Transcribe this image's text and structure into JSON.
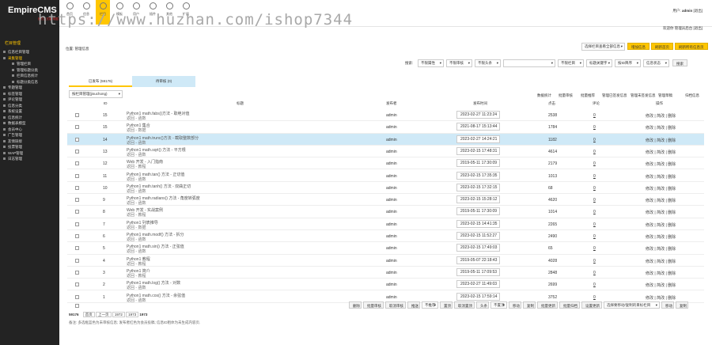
{
  "top": {
    "brand": "EmpireCMS",
    "brand_sub": "官方正式版·帝国",
    "nav": [
      "首页",
      "信息",
      "栏目",
      "模板",
      "用户",
      "插件",
      "其他",
      "扩展"
    ],
    "nav_active": 2,
    "watermark": "https://www.huzhan.com/ishop7344",
    "user_label": "用户:",
    "user": "admin",
    "logout": "[退出]",
    "user_line2": "欢迎你 管理员后台 [退出]"
  },
  "sidebar": {
    "title": "栏目管理",
    "items": [
      {
        "t": "信息栏目管理",
        "s": 0,
        "c": 0
      },
      {
        "t": "采集管理",
        "s": 0,
        "c": 1
      },
      {
        "t": "管理栏目",
        "s": 1,
        "c": 0
      },
      {
        "t": "管理标题分类",
        "s": 1,
        "c": 0
      },
      {
        "t": "栏目信息统计",
        "s": 1,
        "c": 0
      },
      {
        "t": "标题分类信息",
        "s": 1,
        "c": 0
      },
      {
        "t": "专题管理",
        "s": 0,
        "c": 0
      },
      {
        "t": "标签管理",
        "s": 0,
        "c": 0
      },
      {
        "t": "评论管理",
        "s": 0,
        "c": 0
      },
      {
        "t": "信息分类",
        "s": 0,
        "c": 0
      },
      {
        "t": "系统设置",
        "s": 0,
        "c": 0
      },
      {
        "t": "信息统计",
        "s": 0,
        "c": 0
      },
      {
        "t": "数据表模型",
        "s": 0,
        "c": 0
      },
      {
        "t": "会员中心",
        "s": 0,
        "c": 0
      },
      {
        "t": "广告管理",
        "s": 0,
        "c": 0
      },
      {
        "t": "友情链接",
        "s": 0,
        "c": 0
      },
      {
        "t": "投票管理",
        "s": 0,
        "c": 0
      },
      {
        "t": "WAP管理",
        "s": 0,
        "c": 0
      },
      {
        "t": "日志管理",
        "s": 0,
        "c": 0
      }
    ]
  },
  "main": {
    "location": "位置: 管理信息",
    "search_select": "选择栏目查看全部信息",
    "btn_add": "增加信息",
    "btn_refresh": "刷新首页",
    "btn_refresh_all": "刷新所有信息页",
    "filter": {
      "label": "搜索:",
      "opts": [
        "不限属性",
        "不限审核",
        "不限头条",
        "不限字段"
      ],
      "keyword": "",
      "more": [
        "不限栏目",
        "标题关键字",
        "按ID降序",
        "信息状态"
      ],
      "btn": "搜索"
    },
    "tabs": [
      "已发布 (59176)",
      "待审核 (0)"
    ],
    "view_select": "按栏目管理(jisuchong)",
    "links": [
      "数据统计",
      "批量审核",
      "批量推荐",
      "管理已签发信息",
      "管理未签发信息",
      "管理草稿",
      "归档信息"
    ],
    "headers": {
      "id": "ID",
      "title": "标题",
      "publisher": "发布者",
      "date": "发布时间",
      "hits": "点击",
      "comments": "评论",
      "ops": "操作"
    },
    "rows": [
      {
        "id": "15",
        "t1": "Python1 math.fabs()方法 - 取绝对值",
        "t2": "返回 - 函数",
        "pub": "admin",
        "date": "2023-02-27 11:23:24",
        "hits": "2538",
        "cmt": "0",
        "ops": "修改 | 简改 | 删除"
      },
      {
        "id": "15",
        "t1": "Python1 集合",
        "t2": "返回 - 数据",
        "pub": "admin",
        "date": "2021-08-17 15:13:44",
        "hits": "1784",
        "cmt": "0",
        "ops": "修改 | 简改 | 删除"
      },
      {
        "id": "14",
        "t1": "Python1 math.trunc()方法 - 截取整数部分",
        "t2": "返回 - 函数",
        "pub": "admin",
        "date": "2023-02-27 14:24:21",
        "hits": "1182",
        "cmt": "0",
        "ops": "修改 | 简改 | 删除"
      },
      {
        "id": "13",
        "t1": "Python1 math.sqrt() 方法 - 平方根",
        "t2": "返回 - 函数",
        "pub": "admin",
        "date": "2023-02-15 17:48:31",
        "hits": "4614",
        "cmt": "0",
        "ops": "修改 | 简改 | 删除"
      },
      {
        "id": "12",
        "t1": "Web 开发 - 入门指南",
        "t2": "返回 - 教程",
        "pub": "admin",
        "date": "2019-05-11 17:30:09",
        "hits": "2179",
        "cmt": "0",
        "ops": "修改 | 简改 | 删除"
      },
      {
        "id": "11",
        "t1": "Python1 math.tan() 方法 - 正切值",
        "t2": "返回 - 函数",
        "pub": "admin",
        "date": "2023-02-15 17:35:35",
        "hits": "1013",
        "cmt": "0",
        "ops": "修改 | 简改 | 删除"
      },
      {
        "id": "10",
        "t1": "Python1 math.tanh() 方法 - 双曲正切",
        "t2": "返回 - 函数",
        "pub": "admin",
        "date": "2023-02-15 17:32:15",
        "hits": "68",
        "cmt": "0",
        "ops": "修改 | 简改 | 删除"
      },
      {
        "id": "9",
        "t1": "Python1 math.radians() 方法 - 角度转弧度",
        "t2": "返回 - 函数",
        "pub": "admin",
        "date": "2023-02-15 15:28:12",
        "hits": "4620",
        "cmt": "0",
        "ops": "修改 | 简改 | 删除"
      },
      {
        "id": "8",
        "t1": "Web 开发 - 实战案例",
        "t2": "返回 - 教程",
        "pub": "admin",
        "date": "2019-05-11 17:30:09",
        "hits": "1014",
        "cmt": "0",
        "ops": "修改 | 简改 | 删除"
      },
      {
        "id": "7",
        "t1": "Python1 列表推导",
        "t2": "返回 - 数据",
        "pub": "admin",
        "date": "2023-02-15 14:41:35",
        "hits": "2265",
        "cmt": "0",
        "ops": "修改 | 简改 | 删除"
      },
      {
        "id": "6",
        "t1": "Python1 math.modf() 方法 - 拆分",
        "t2": "返回 - 函数",
        "pub": "admin",
        "date": "2023-02-15 11:52:27",
        "hits": "2490",
        "cmt": "0",
        "ops": "修改 | 简改 | 删除"
      },
      {
        "id": "5",
        "t1": "Python1 math.sin() 方法 - 正弦值",
        "t2": "返回 - 函数",
        "pub": "admin",
        "date": "2023-02-15 17:49:03",
        "hits": "65",
        "cmt": "0",
        "ops": "修改 | 简改 | 删除"
      },
      {
        "id": "4",
        "t1": "Python1 教程",
        "t2": "返回 - 教程",
        "pub": "admin",
        "date": "2019-05-07 22:18:43",
        "hits": "4028",
        "cmt": "0",
        "ops": "修改 | 简改 | 删除"
      },
      {
        "id": "3",
        "t1": "Python1 简介",
        "t2": "返回 - 教程",
        "pub": "admin",
        "date": "2019-05-11 17:09:53",
        "hits": "2848",
        "cmt": "0",
        "ops": "修改 | 简改 | 删除"
      },
      {
        "id": "2",
        "t1": "Python1 math.log() 方法 - 对数",
        "t2": "返回 - 函数",
        "pub": "admin",
        "date": "2023-02-27 11:49:03",
        "hits": "2699",
        "cmt": "0",
        "ops": "修改 | 简改 | 删除"
      },
      {
        "id": "1",
        "t1": "Python1 math.cos() 方法 - 余弦值",
        "t2": "返回 - 函数",
        "pub": "admin",
        "date": "2023-02-15 17:59:14",
        "hits": "3752",
        "cmt": "0",
        "ops": "修改 | 简改 | 删除"
      }
    ],
    "bottom_buttons": [
      "删除",
      "批量审核",
      "取消审核",
      "推送",
      "不推荐",
      "置顶",
      "取消置顶",
      "头条",
      "不置顶",
      "移动",
      "复制",
      "批量更新",
      "批量归档",
      "设置更新",
      "选择要移动/复制的目标栏目",
      "移动",
      "复制"
    ],
    "pagination": {
      "total": "59176",
      "first": "首页",
      "prev": "上一页",
      "p1": "1972",
      "p2": "1973",
      "current": "1973"
    },
    "note": "备注: 多选框蓝色为未审核信息; 发布者红色为会员投稿; 信息ID粗体为未生成内容页."
  }
}
